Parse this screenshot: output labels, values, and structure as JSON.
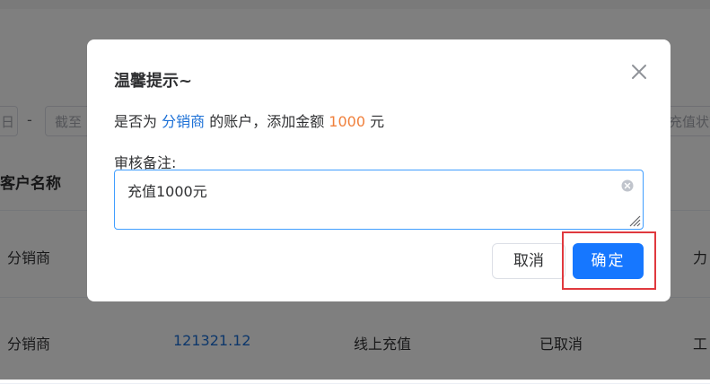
{
  "background": {
    "filters": {
      "start_date_partial": "日",
      "range_separator": "-",
      "end_date_placeholder_partial": "截至",
      "status_placeholder_partial": "充值状态"
    },
    "table": {
      "header_customer": "客户名称",
      "rows": [
        {
          "customer": "分销商",
          "amount": "",
          "method": "",
          "status": "",
          "extra": "力"
        },
        {
          "customer": "分销商",
          "amount": "121321.12",
          "method": "线上充值",
          "status": "已取消",
          "extra": "工"
        }
      ]
    }
  },
  "dialog": {
    "title": "温馨提示~",
    "message": {
      "prefix": "是否为 ",
      "target": "分销商",
      "middle": " 的账户，添加金额 ",
      "amount": "1000",
      "suffix": " 元"
    },
    "remark_label": "审核备注:",
    "remark_value": "充值1000元",
    "cancel_label": "取消",
    "confirm_label": "确定"
  },
  "colors": {
    "link": "#1a6fd6",
    "amount": "#f0803c",
    "primary": "#1677ff",
    "highlight": "#e0393e"
  },
  "icons": [
    "close-icon",
    "clear-icon",
    "resize-handle-icon"
  ]
}
